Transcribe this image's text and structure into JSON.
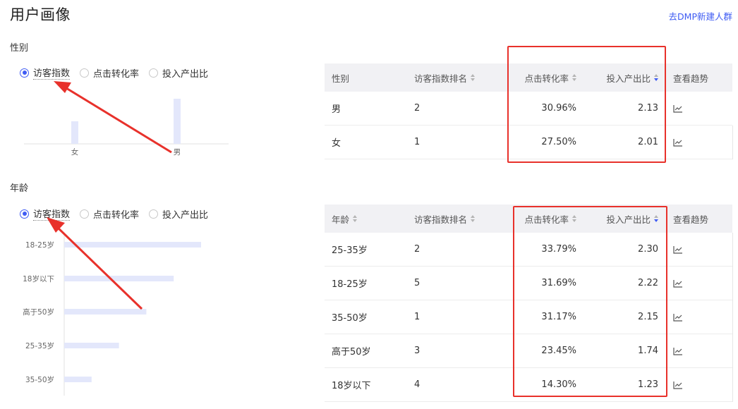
{
  "header": {
    "title": "用户画像",
    "dmp_link": "去DMP新建人群"
  },
  "gender": {
    "title": "性别",
    "radios": [
      {
        "label": "访客指数",
        "selected": true
      },
      {
        "label": "点击转化率",
        "selected": false
      },
      {
        "label": "投入产出比",
        "selected": false
      }
    ],
    "chart": {
      "type": "bar",
      "categories": [
        "女",
        "男"
      ],
      "values": [
        1,
        2
      ],
      "xlabel": "",
      "ylabel": "",
      "ylim": [
        0,
        2
      ]
    },
    "table": {
      "columns": [
        {
          "label": "性别",
          "sortable": false
        },
        {
          "label": "访客指数排名",
          "sortable": true
        },
        {
          "label": "点击转化率",
          "sortable": true
        },
        {
          "label": "投入产出比",
          "sortable": true,
          "active": true
        },
        {
          "label": "查看趋势",
          "sortable": false
        }
      ],
      "rows": [
        {
          "name": "男",
          "rank": "2",
          "ctr": "30.96%",
          "roi": "2.13"
        },
        {
          "name": "女",
          "rank": "1",
          "ctr": "27.50%",
          "roi": "2.01"
        }
      ]
    }
  },
  "age": {
    "title": "年龄",
    "radios": [
      {
        "label": "访客指数",
        "selected": true
      },
      {
        "label": "点击转化率",
        "selected": false
      },
      {
        "label": "投入产出比",
        "selected": false
      }
    ],
    "chart": {
      "type": "bar",
      "orientation": "horizontal",
      "categories": [
        "18-25岁",
        "18岁以下",
        "高于50岁",
        "25-35岁",
        "35-50岁"
      ],
      "values": [
        5,
        4,
        3,
        2,
        1
      ],
      "xlabel": "",
      "ylabel": "",
      "xlim": [
        0,
        5
      ]
    },
    "table": {
      "columns": [
        {
          "label": "年龄",
          "sortable": true
        },
        {
          "label": "访客指数排名",
          "sortable": true
        },
        {
          "label": "点击转化率",
          "sortable": true
        },
        {
          "label": "投入产出比",
          "sortable": true,
          "active": true
        },
        {
          "label": "查看趋势",
          "sortable": false
        }
      ],
      "rows": [
        {
          "name": "25-35岁",
          "rank": "2",
          "ctr": "33.79%",
          "roi": "2.30"
        },
        {
          "name": "18-25岁",
          "rank": "5",
          "ctr": "31.69%",
          "roi": "2.22"
        },
        {
          "name": "35-50岁",
          "rank": "1",
          "ctr": "31.17%",
          "roi": "2.15"
        },
        {
          "name": "高于50岁",
          "rank": "3",
          "ctr": "23.45%",
          "roi": "1.74"
        },
        {
          "name": "18岁以下",
          "rank": "4",
          "ctr": "14.30%",
          "roi": "1.23"
        }
      ]
    }
  },
  "colors": {
    "accent": "#3f5cf3",
    "bar": "#e3e7fb",
    "header_bg": "#f1f1f4",
    "annotation": "#e8312b"
  },
  "icons": {
    "trend": "line-chart-icon",
    "sort": "sort-caret-icon",
    "annotation_arrow": "red-arrow"
  }
}
